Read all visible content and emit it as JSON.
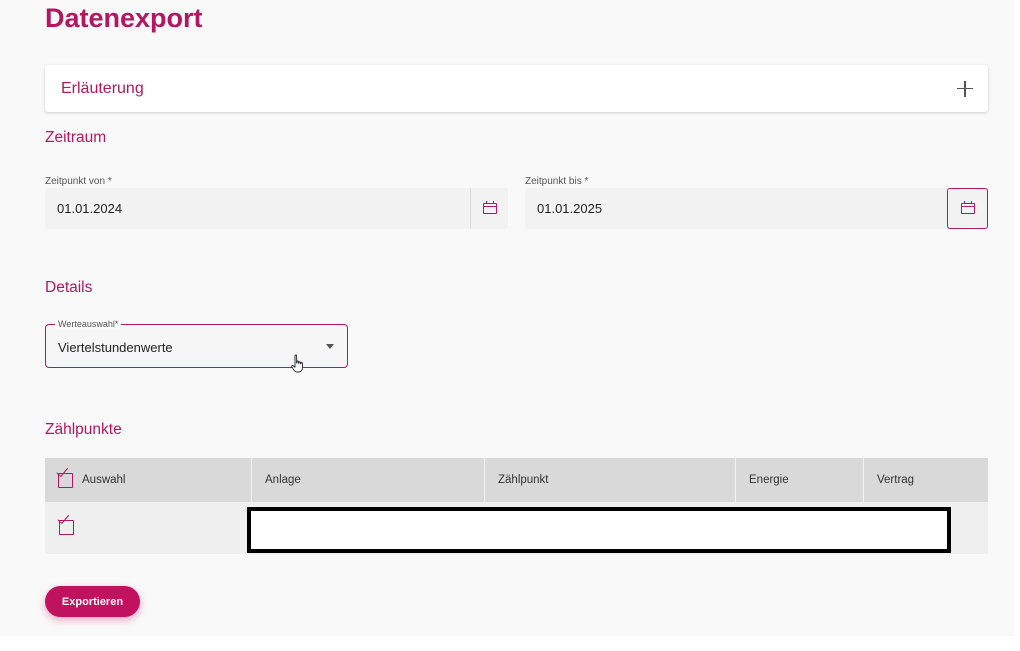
{
  "page": {
    "title": "Datenexport"
  },
  "explanation": {
    "label": "Erläuterung",
    "icon": "plus-icon"
  },
  "period": {
    "section_title": "Zeitraum",
    "from": {
      "label": "Zeitpunkt von *",
      "value": "01.01.2024",
      "icon": "calendar-icon"
    },
    "to": {
      "label": "Zeitpunkt bis *",
      "value": "01.01.2025",
      "icon": "calendar-icon"
    }
  },
  "details": {
    "section_title": "Details",
    "value_select": {
      "label": "Werteauswahl*",
      "value": "Viertelstundenwerte",
      "icon": "caret-down-icon"
    }
  },
  "meter_points": {
    "section_title": "Zählpunkte",
    "columns": [
      "Auswahl",
      "Anlage",
      "Zählpunkt",
      "Energie",
      "Vertrag"
    ],
    "rows": [
      {
        "selected": true
      }
    ]
  },
  "actions": {
    "export_label": "Exportieren"
  },
  "colors": {
    "accent": "#b3175f",
    "button": "#c0125e"
  }
}
